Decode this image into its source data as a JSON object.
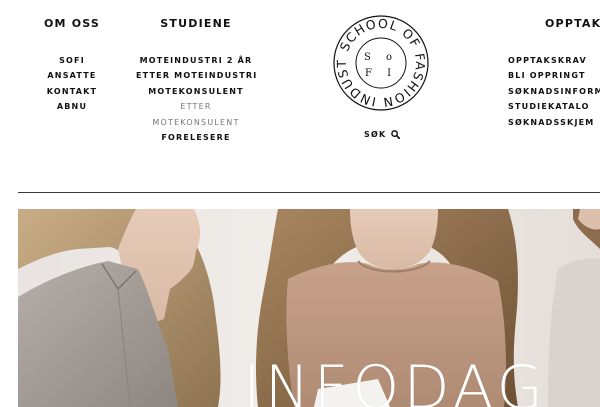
{
  "nav": {
    "om_oss": {
      "heading": "OM OSS",
      "items": [
        "SOFI",
        "ANSATTE",
        "KONTAKT",
        "ABNU"
      ]
    },
    "studiene": {
      "heading": "STUDIENE",
      "items": [
        "MOTEINDUSTRI 2 ÅR",
        "ETTER MOTEINDUSTRI",
        "MOTEKONSULENT",
        "ETTER",
        "MOTEKONSULENT",
        "FORELESERE"
      ]
    },
    "opptak": {
      "heading": "OPPTAK",
      "items": [
        "OPPTAKSKRAV",
        "BLI OPPRINGT",
        "SØKNADSINFORMA",
        "STUDIEKATALO",
        "SØKNADSSKJEM"
      ]
    }
  },
  "logo": {
    "ring_text": "SCHOOL OF FASHION INDUSTRY",
    "mono_top": "S o",
    "mono_bottom": "F I"
  },
  "search": {
    "label": "SØK",
    "icon": "search-icon"
  },
  "hero": {
    "title": "INFODAG"
  },
  "colors": {
    "text": "#111111",
    "muted": "#777777",
    "divider": "#3a3a3a",
    "hero_bg": "#ece6e2"
  }
}
